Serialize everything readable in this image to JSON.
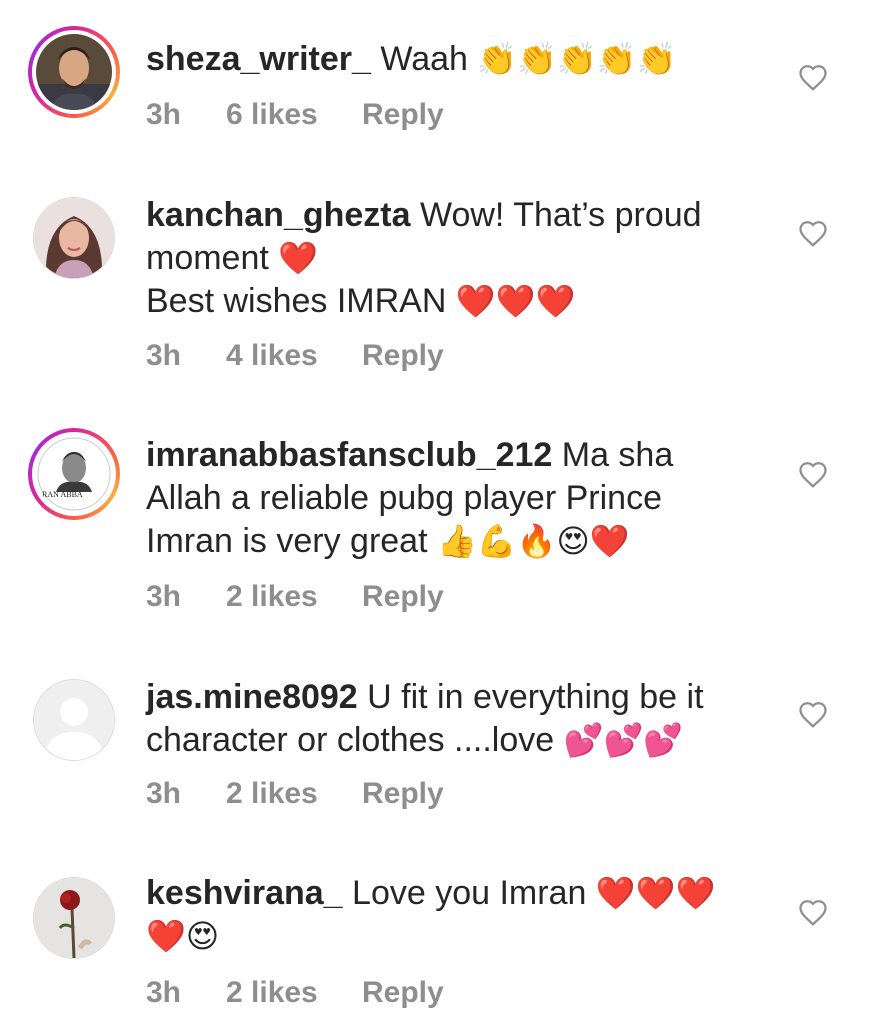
{
  "comments": [
    {
      "username": "sheza_writer_",
      "text": "Waah",
      "emojis": "👏👏👏👏👏",
      "time": "3h",
      "likes": "6 likes",
      "reply": "Reply"
    },
    {
      "username": "kanchan_ghezta",
      "text": "Wow! That’s proud moment",
      "emojis": "❤️",
      "text2": "Best wishes IMRAN",
      "emojis2": "❤️❤️❤️",
      "time": "3h",
      "likes": "4 likes",
      "reply": "Reply"
    },
    {
      "username": "imranabbasfansclub_212",
      "text": "Ma sha Allah a reliable pubg player Prince Imran is very great",
      "emojis": "👍💪🔥😍❤️",
      "avatar_text": "RAN ABBA",
      "time": "3h",
      "likes": "2 likes",
      "reply": "Reply"
    },
    {
      "username": "jas.mine8092",
      "text": "U fit in everything be it character or clothes ....love",
      "emojis": "💕💕💕",
      "time": "3h",
      "likes": "2 likes",
      "reply": "Reply"
    },
    {
      "username": "keshvirana_",
      "text": "Love you Imran",
      "emojis": "❤️❤️❤️",
      "emojis2": "❤️😍",
      "time": "3h",
      "likes": "2 likes",
      "reply": "Reply"
    }
  ],
  "colors": {
    "text": "#262626",
    "meta": "#8e8e8e",
    "heart": "#8e8e8e"
  },
  "icons": {
    "like": "heart-outline-icon"
  }
}
